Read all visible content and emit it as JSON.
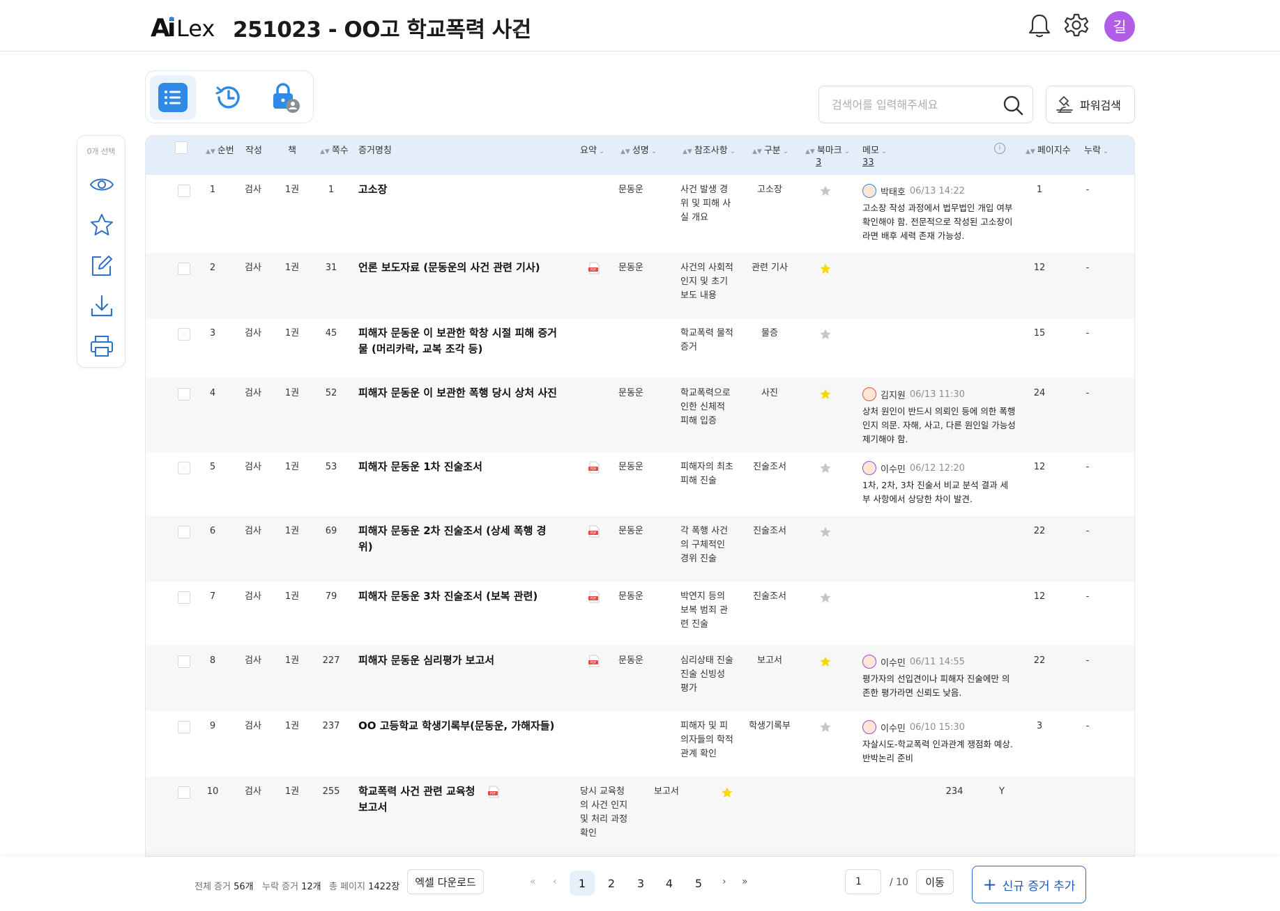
{
  "header": {
    "logo_text": "AiLex",
    "title": "251023 - OO고 학교폭력 사건",
    "avatar_initial": "길"
  },
  "search": {
    "placeholder": "검색어를 입력해주세요"
  },
  "power_search_label": "파워검색",
  "sidebar": {
    "selected_count": "0개 선택"
  },
  "columns": {
    "seq": "순번",
    "author": "작성",
    "volume": "책",
    "page": "쪽수",
    "name": "증거명칭",
    "summary": "요약",
    "person": "성명",
    "ref": "참조사항",
    "category": "구분",
    "bookmark": "북마크",
    "bookmark_count": "3",
    "memo": "메모",
    "memo_count": "33",
    "pages": "페이지수",
    "missing": "누락"
  },
  "rows": [
    {
      "seq": "1",
      "author": "검사",
      "volume": "1권",
      "page": "1",
      "name": "고소장",
      "pdf": false,
      "person": "문동운",
      "ref": "사건 발생 경위 및 피해 사실 개요",
      "category": "고소장",
      "starred": false,
      "memo": {
        "user": "박태호",
        "time": "06/13 14:22",
        "text": "고소장 작성 과정에서 법무법인 개입 여부 확인해야 함. 전문적으로 작성된 고소장이라면 배후 세력 존재 가능성."
      },
      "pages": "1",
      "missing": "-"
    },
    {
      "seq": "2",
      "author": "검사",
      "volume": "1권",
      "page": "31",
      "name": "언론 보도자료 (문동운의 사건 관련 기사)",
      "pdf": true,
      "person": "문동운",
      "ref": "사건의 사회적 인지 및 초기 보도 내용",
      "category": "관련 기사",
      "starred": true,
      "memo": null,
      "pages": "12",
      "missing": "-"
    },
    {
      "seq": "3",
      "author": "검사",
      "volume": "1권",
      "page": "45",
      "name": "피해자 문동운 이 보관한 학창 시절 피해 증거물 (머리카락, 교복 조각 등)",
      "pdf": false,
      "person": "",
      "ref": "학교폭력 물적 증거",
      "category": "물증",
      "starred": false,
      "memo": null,
      "pages": "15",
      "missing": "-"
    },
    {
      "seq": "4",
      "author": "검사",
      "volume": "1권",
      "page": "52",
      "name": "피해자 문동운 이 보관한 폭행 당시 상처 사진",
      "pdf": false,
      "person": "문동운",
      "ref": "학교폭력으로 인한 신체적 피해 입증",
      "category": "사진",
      "starred": true,
      "memo": {
        "user": "김지원",
        "time": "06/13 11:30",
        "text": "상처 원인이 반드시 의뢰인 등에 의한 폭행인지 의문. 자해, 사고, 다른 원인일 가능성 제기해야 함."
      },
      "pages": "24",
      "missing": "-"
    },
    {
      "seq": "5",
      "author": "검사",
      "volume": "1권",
      "page": "53",
      "name": "피해자 문동운 1차 진술조서",
      "pdf": true,
      "person": "문동운",
      "ref": "피해자의 최초 피해 진술",
      "category": "진술조서",
      "starred": false,
      "memo": {
        "user": "이수민",
        "time": "06/12 12:20",
        "text": "1차, 2차, 3차 진술서 비교 분석 결과 세부 사항에서 상당한 차이 발견."
      },
      "pages": "12",
      "missing": "-"
    },
    {
      "seq": "6",
      "author": "검사",
      "volume": "1권",
      "page": "69",
      "name": "피해자 문동운 2차 진술조서 (상세 폭행 경위)",
      "pdf": true,
      "person": "문동운",
      "ref": "각 폭행 사건의 구체적인 경위 진술",
      "category": "진술조서",
      "starred": false,
      "memo": null,
      "pages": "22",
      "missing": "-"
    },
    {
      "seq": "7",
      "author": "검사",
      "volume": "1권",
      "page": "79",
      "name": "피해자 문동운 3차 진술조서 (보복 관련)",
      "pdf": true,
      "person": "문동운",
      "ref": "박연지 등의 보복 범죄 관련 진술",
      "category": "진술조서",
      "starred": false,
      "memo": null,
      "pages": "12",
      "missing": "-"
    },
    {
      "seq": "8",
      "author": "검사",
      "volume": "1권",
      "page": "227",
      "name": "피해자 문동운 심리평가 보고서",
      "pdf": true,
      "person": "문동운",
      "ref": "심리상태 진술 진술 신빙성 평가",
      "category": "보고서",
      "starred": true,
      "memo": {
        "user": "이수민",
        "time": "06/11 14:55",
        "text": " 평가자의 선입견이나 피해자 진술에만 의존한 평가라면 신뢰도 낮음."
      },
      "pages": "22",
      "missing": "-"
    },
    {
      "seq": "9",
      "author": "검사",
      "volume": "1권",
      "page": "237",
      "name": "OO 고등학교 학생기록부(문동운, 가해자들)",
      "pdf": false,
      "person": "",
      "ref": "피해자 및 피의자들의 학적 관계 확인",
      "category": "학생기록부",
      "starred": false,
      "memo": {
        "user": "이수민",
        "time": "06/10 15:30",
        "text": "자살시도-학교폭력 인과관계 쟁점화 예상. 반박논리 준비"
      },
      "pages": "3",
      "missing": "-"
    },
    {
      "seq": "10",
      "author": "검사",
      "volume": "1권",
      "page": "255",
      "name": "학교폭력 사건 관련 교육청 보고서",
      "pdf": true,
      "summary": "당시 교육청의 사건 인지 및 처리 과정 확인",
      "category": "보고서",
      "starred": true,
      "pages": "234",
      "missing": "Y"
    }
  ],
  "footer": {
    "total_label": "전체 증거",
    "total_value": "56개",
    "missing_label": "누락 증거",
    "missing_value": "12개",
    "pages_label": "총 페이지",
    "pages_value": "1422장",
    "excel_label": "엑셀 다운로드",
    "pages": [
      "1",
      "2",
      "3",
      "4",
      "5"
    ],
    "current_page_input": "1",
    "of_total": "/ 10",
    "go_label": "이동",
    "add_label": "신규 증거 추가"
  },
  "colors": {
    "accent": "#2f8ae6",
    "star_on": "#f5d90a",
    "star_off": "#c4c7cc",
    "avatar": "#b25de8",
    "pdf": "#e24b4b"
  }
}
